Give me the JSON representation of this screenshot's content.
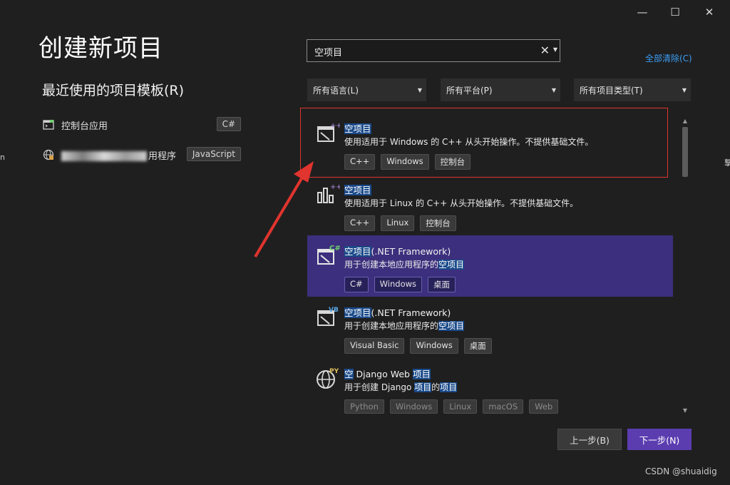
{
  "window": {
    "minimize_glyph": "—",
    "maximize_glyph": "☐",
    "close_glyph": "✕"
  },
  "page": {
    "title": "创建新项目",
    "recent_title": "最近使用的项目模板(R)",
    "clear_all": "全部清除(C)"
  },
  "recent": [
    {
      "label": "控制台应用",
      "tag": "C#",
      "icon": "console-app-icon"
    },
    {
      "label_visible_suffix": "用程序",
      "tag": "JavaScript",
      "icon": "globe-icon"
    }
  ],
  "search": {
    "value": "空项目",
    "clear_glyph": "✕"
  },
  "filters": {
    "language": "所有语言(L)",
    "platform": "所有平台(P)",
    "project_type": "所有项目类型(T)"
  },
  "templates": [
    {
      "name": "空项目",
      "desc_pre": "",
      "desc_hl": "",
      "desc": "使用适用于 Windows 的 C++ 从头开始操作。不提供基础文件。",
      "tags": [
        "C++",
        "Windows",
        "控制台"
      ],
      "icon": "cpp-windows-empty-icon",
      "badge": "++",
      "badge_color": "#b48ae6"
    },
    {
      "name": "空项目",
      "desc": "使用适用于 Linux 的 C++ 从头开始操作。不提供基础文件。",
      "tags": [
        "C++",
        "Linux",
        "控制台"
      ],
      "icon": "cpp-linux-empty-icon",
      "badge": "++",
      "badge_color": "#b48ae6"
    },
    {
      "name_hl": "空项目",
      "name_rest": "(.NET Framework)",
      "desc_pre": "用于创建本地应用程序的",
      "desc_hl": "空项目",
      "tags": [
        "C#",
        "Windows",
        "桌面"
      ],
      "icon": "csharp-empty-icon",
      "badge": "C#",
      "badge_color": "#6fd16f",
      "selected": true
    },
    {
      "name_hl": "空项目",
      "name_rest": "(.NET Framework)",
      "desc_pre": "用于创建本地应用程序的",
      "desc_hl": "空项目",
      "tags": [
        "Visual Basic",
        "Windows",
        "桌面"
      ],
      "icon": "vb-empty-icon",
      "badge": "VB",
      "badge_color": "#5aa8e6"
    },
    {
      "name_hl1": "空",
      "name_mid": " Django Web ",
      "name_hl2": "项目",
      "desc_pre": "用于创建 Django ",
      "desc_hl1": "项目",
      "desc_mid": "的",
      "desc_hl2": "项目",
      "tags": [
        "Python",
        "Windows",
        "Linux",
        "macOS",
        "Web"
      ],
      "icon": "python-globe-icon",
      "badge": "PY",
      "badge_color": "#e0c060"
    }
  ],
  "buttons": {
    "back": "上一步(B)",
    "next": "下一步(N)"
  },
  "watermark": "CSDN @shuaidig",
  "edges": {
    "left": "n",
    "right": "撃"
  },
  "colors": {
    "accent": "#5b3db0",
    "selected_row": "#3c2f7d",
    "link": "#3b9df5",
    "highlight": "#1a4a8a",
    "annotation": "#e0342e"
  }
}
